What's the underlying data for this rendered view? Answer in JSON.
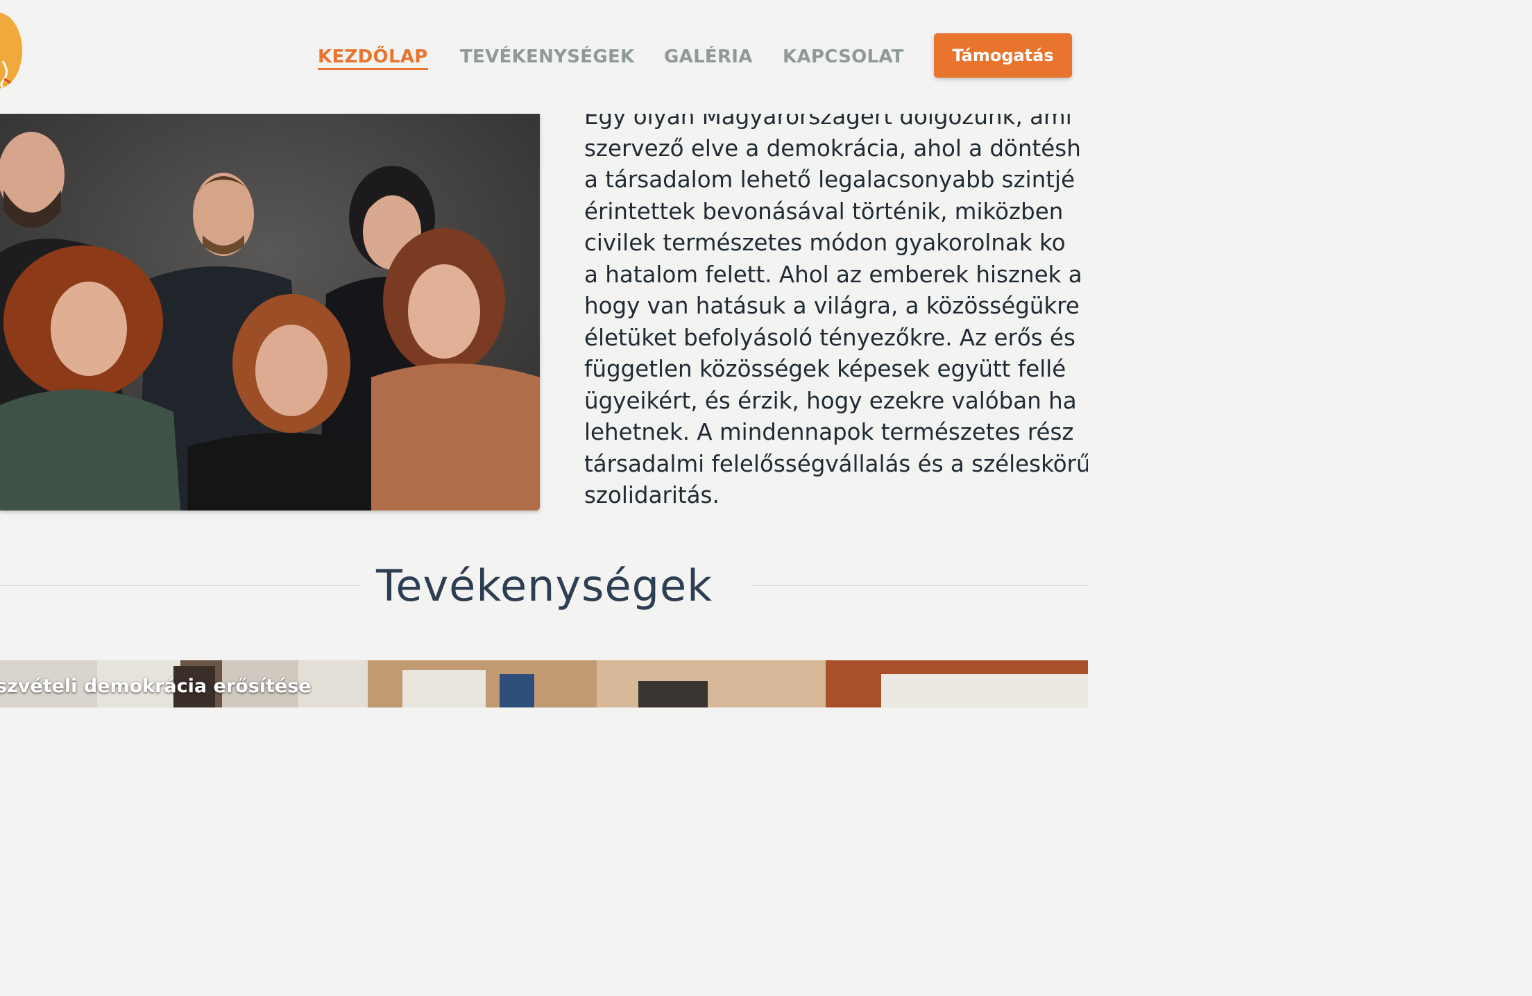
{
  "nav": {
    "items": [
      {
        "label": "KEZDŐLAP",
        "active": true
      },
      {
        "label": "TEVÉKENYSÉGEK",
        "active": false
      },
      {
        "label": "GALÉRIA",
        "active": false
      },
      {
        "label": "KAPCSOLAT",
        "active": false
      }
    ],
    "support_label": "Támogatás"
  },
  "intro": {
    "lines": [
      "Egy olyan Magyarországért dolgozunk, ami",
      "szervező elve a demokrácia, ahol a döntésh",
      "a társadalom lehető legalacsonyabb szintjé",
      "érintettek bevonásával történik, miközben",
      "civilek természetes módon gyakorolnak ko",
      "a hatalom felett. Ahol az emberek hisznek a",
      "hogy van hatásuk a világra, a közösségükre",
      "életüket befolyásoló tényezőkre. Az erős és",
      "független közösségek képesek együtt fellé",
      "ügyeikért, és érzik, hogy ezekre valóban ha",
      "lehetnek. A mindennapok természetes rész",
      "társadalmi felelősségvállalás és a széleskörű",
      "szolidaritás."
    ]
  },
  "activities": {
    "section_title": "Tevékenységek",
    "cards": [
      {
        "title": "szvételi demokrácia erősítése"
      }
    ]
  },
  "colors": {
    "accent": "#e8742e",
    "nav_inactive": "#8f9a96",
    "heading": "#2e3e52",
    "body_text": "#1f2a33",
    "background": "#f3f3f2",
    "logo": "#f0a93a"
  }
}
